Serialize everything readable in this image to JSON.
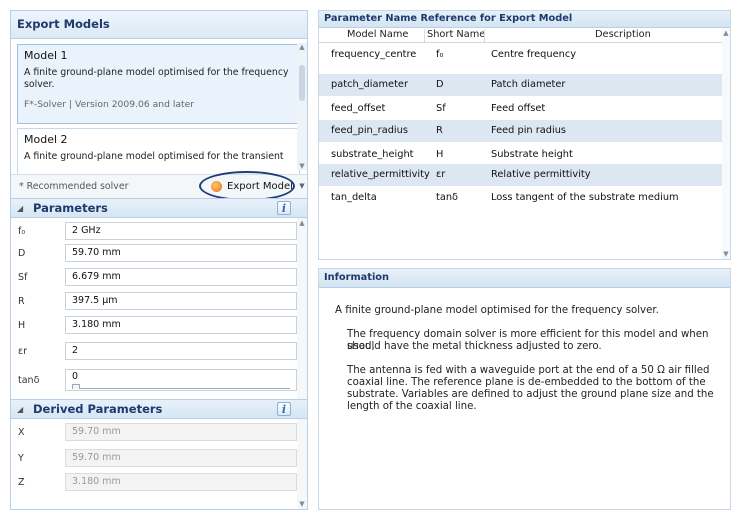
{
  "export_models": {
    "title": "Export Models",
    "models": [
      {
        "name": "Model 1",
        "description": "A finite ground-plane model optimised for the frequency solver.",
        "meta": "F*-Solver | Version 2009.06 and later"
      },
      {
        "name": "Model 2",
        "description": "A finite ground-plane model optimised for the transient"
      }
    ],
    "recommended_note": "* Recommended solver",
    "export_button_label": "Export Model"
  },
  "parameters": {
    "title": "Parameters",
    "info_icon": "i",
    "rows": [
      {
        "label": "f₀",
        "value": "2 GHz"
      },
      {
        "label": "D",
        "value": "59.70 mm"
      },
      {
        "label": "Sf",
        "value": "6.679 mm"
      },
      {
        "label": "R",
        "value": "397.5 µm"
      },
      {
        "label": "H",
        "value": "3.180 mm"
      },
      {
        "label": "εr",
        "value": "2"
      },
      {
        "label": "tanδ",
        "value": "0"
      }
    ]
  },
  "derived_parameters": {
    "title": "Derived Parameters",
    "info_icon": "i",
    "rows": [
      {
        "label": "X",
        "value": "59.70 mm"
      },
      {
        "label": "Y",
        "value": "59.70 mm"
      },
      {
        "label": "Z",
        "value": "3.180 mm"
      }
    ]
  },
  "reference": {
    "title": "Parameter Name Reference for Export Model",
    "columns": [
      "Model Name",
      "Short Name",
      "Description"
    ],
    "rows": [
      {
        "model_name": "frequency_centre",
        "short_name": "f₀",
        "description": "Centre frequency"
      },
      {
        "model_name": "patch_diameter",
        "short_name": "D",
        "description": "Patch diameter"
      },
      {
        "model_name": "feed_offset",
        "short_name": "Sf",
        "description": "Feed offset"
      },
      {
        "model_name": "feed_pin_radius",
        "short_name": "R",
        "description": "Feed pin radius"
      },
      {
        "model_name": "substrate_height",
        "short_name": "H",
        "description": "Substrate height"
      },
      {
        "model_name": "relative_permittivity",
        "short_name": "εr",
        "description": "Relative permittivity"
      },
      {
        "model_name": "tan_delta",
        "short_name": "tanδ",
        "description": "Loss tangent of the substrate medium"
      }
    ]
  },
  "information": {
    "title": "Information",
    "summary": "A finite ground-plane model optimised for the frequency solver.",
    "para1_line1": "The frequency domain solver is more efficient for this model and when used,",
    "para1_line2": "should have the metal thickness adjusted to zero.",
    "para2_line1": "The antenna is fed with a waveguide port at the end of a 50 Ω air filled",
    "para2_line2": "coaxial line. The reference plane is de-embedded to the bottom of the",
    "para2_line3": "substrate. Variables are defined to adjust the ground plane size and the",
    "para2_line4": "length of the coaxial line."
  }
}
